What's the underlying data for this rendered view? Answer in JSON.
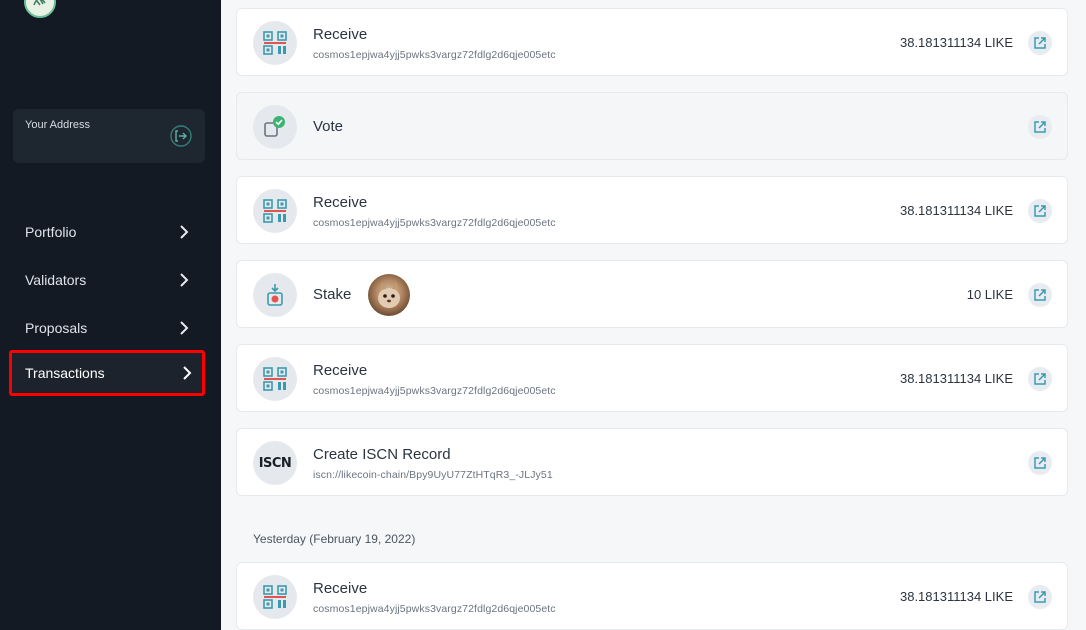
{
  "sidebar": {
    "address_label": "Your Address",
    "nav": [
      {
        "label": "Portfolio"
      },
      {
        "label": "Validators"
      },
      {
        "label": "Proposals"
      },
      {
        "label": "Transactions",
        "active": true
      }
    ]
  },
  "transactions": [
    {
      "type": "Receive",
      "sub": "cosmos1epjwa4yjj5pwks3vargz72fdlg2d6qje005etc",
      "amount": "38.181311134 LIKE",
      "icon": "qr-receive-icon"
    },
    {
      "type": "Vote",
      "icon": "vote-check-icon"
    },
    {
      "type": "Receive",
      "sub": "cosmos1epjwa4yjj5pwks3vargz72fdlg2d6qje005etc",
      "amount": "38.181311134 LIKE",
      "icon": "qr-receive-icon"
    },
    {
      "type": "Stake",
      "amount": "10 LIKE",
      "icon": "stake-icon",
      "validator_avatar": "validator-avatar"
    },
    {
      "type": "Receive",
      "sub": "cosmos1epjwa4yjj5pwks3vargz72fdlg2d6qje005etc",
      "amount": "38.181311134 LIKE",
      "icon": "qr-receive-icon"
    },
    {
      "type": "Create ISCN Record",
      "sub": "iscn://likecoin-chain/Bpy9UyU77ZtHTqR3_-JLJy51",
      "icon": "iscn-logo-icon",
      "icon_text": "ISCN"
    }
  ],
  "date_group": "Yesterday (February 19, 2022)",
  "yesterday_transactions": [
    {
      "type": "Receive",
      "sub": "cosmos1epjwa4yjj5pwks3vargz72fdlg2d6qje005etc",
      "amount": "38.181311134 LIKE",
      "icon": "qr-receive-icon"
    }
  ],
  "colors": {
    "sidebar_bg": "#131a23",
    "highlight_border": "#ff0000",
    "accent_teal": "#3a9bb0",
    "vote_green": "#3cb371"
  }
}
